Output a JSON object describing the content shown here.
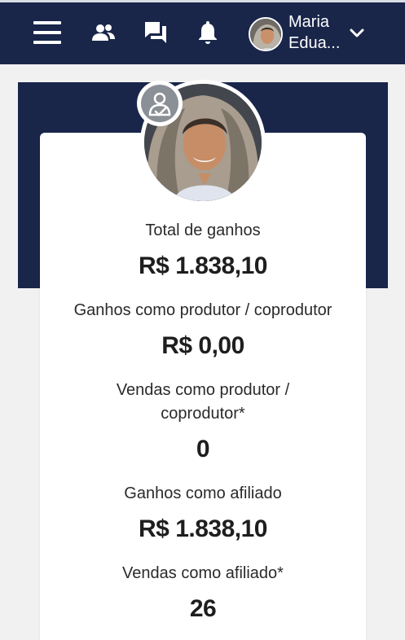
{
  "header": {
    "user_name_line1": "Maria",
    "user_name_line2": "Edua..."
  },
  "icons": {
    "menu": "menu-icon",
    "users": "users-icon",
    "messages": "chat-icon",
    "notifications": "bell-icon",
    "dropdown": "chevron-down-icon"
  },
  "colors": {
    "navy": "#19264a",
    "background": "#f1f1f1",
    "card": "#ffffff"
  },
  "stats": {
    "total_label": "Total de ganhos",
    "total_value": "R$ 1.838,10",
    "producer_earnings_label": "Ganhos como produtor / coprodutor",
    "producer_earnings_value": "R$ 0,00",
    "producer_sales_label_line1": "Vendas como produtor /",
    "producer_sales_label_line2": "coprodutor*",
    "producer_sales_value": "0",
    "affiliate_earnings_label": "Ganhos como afiliado",
    "affiliate_earnings_value": "R$ 1.838,10",
    "affiliate_sales_label": "Vendas como afiliado*",
    "affiliate_sales_value": "26"
  }
}
